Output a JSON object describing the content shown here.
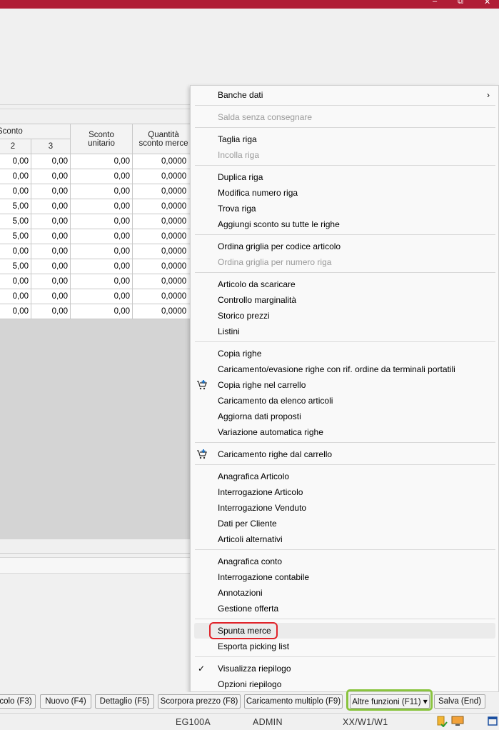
{
  "titlebar": {
    "color": "#b01e36",
    "minimize_glyph": "–",
    "restore_glyph": "⧉",
    "close_glyph": "✕"
  },
  "grid": {
    "header_group": "Sconto",
    "header_col2": "2",
    "header_col3": "3",
    "header_unitario": "Sconto unitario",
    "header_quantita": "Quantità sconto merce",
    "rows": [
      [
        "0,00",
        "0,00",
        "0,00",
        "0,0000"
      ],
      [
        "0,00",
        "0,00",
        "0,00",
        "0,0000"
      ],
      [
        "0,00",
        "0,00",
        "0,00",
        "0,0000"
      ],
      [
        "5,00",
        "0,00",
        "0,00",
        "0,0000"
      ],
      [
        "5,00",
        "0,00",
        "0,00",
        "0,0000"
      ],
      [
        "5,00",
        "0,00",
        "0,00",
        "0,0000"
      ],
      [
        "0,00",
        "0,00",
        "0,00",
        "0,0000"
      ],
      [
        "5,00",
        "0,00",
        "0,00",
        "0,0000"
      ],
      [
        "0,00",
        "0,00",
        "0,00",
        "0,0000"
      ],
      [
        "0,00",
        "0,00",
        "0,00",
        "0,0000"
      ],
      [
        "0,00",
        "0,00",
        "0,00",
        "0,0000"
      ]
    ]
  },
  "menu": {
    "items": [
      {
        "label": "Banche dati",
        "submenu": true
      },
      {
        "label": "Salda senza consegnare",
        "disabled": true
      },
      {
        "label": "Taglia riga"
      },
      {
        "label": "Incolla riga",
        "disabled": true
      },
      {
        "label": "Duplica riga"
      },
      {
        "label": "Modifica numero riga"
      },
      {
        "label": "Trova riga"
      },
      {
        "label": "Aggiungi sconto su tutte le righe"
      },
      {
        "label": "Ordina griglia per codice articolo"
      },
      {
        "label": "Ordina griglia per numero riga",
        "disabled": true
      },
      {
        "label": "Articolo da scaricare"
      },
      {
        "label": "Controllo marginalità"
      },
      {
        "label": "Storico prezzi"
      },
      {
        "label": "Listini"
      },
      {
        "label": "Copia righe"
      },
      {
        "label": "Caricamento/evasione righe con rif. ordine da terminali portatili"
      },
      {
        "label": "Copia righe nel carrello",
        "icon": "cart-add-icon"
      },
      {
        "label": "Caricamento da elenco articoli"
      },
      {
        "label": "Aggiorna dati proposti"
      },
      {
        "label": "Variazione automatica righe"
      },
      {
        "label": "Caricamento righe dal carrello",
        "icon": "cart-add-icon"
      },
      {
        "label": "Anagrafica Articolo"
      },
      {
        "label": "Interrogazione Articolo"
      },
      {
        "label": "Interrogazione Venduto"
      },
      {
        "label": "Dati per Cliente"
      },
      {
        "label": "Articoli alternativi"
      },
      {
        "label": "Anagrafica conto"
      },
      {
        "label": "Interrogazione contabile"
      },
      {
        "label": "Annotazioni"
      },
      {
        "label": "Gestione offerta"
      },
      {
        "label": "Spunta merce",
        "highlighted": true
      },
      {
        "label": "Esporta picking list"
      },
      {
        "label": "Visualizza riepilogo",
        "checked": true
      },
      {
        "label": "Opzioni riepilogo"
      }
    ],
    "submenu_arrow": "›",
    "check_glyph": "✓"
  },
  "buttons": {
    "b1": "colo (F3)",
    "b2": "Nuovo (F4)",
    "b3": "Dettaglio (F5)",
    "b4": "Scorpora prezzo (F8)",
    "b5": "Caricamento multiplo (F9)",
    "b6": "Altre funzioni (F11)",
    "b6_arrow": "▾",
    "b7": "Salva (End)"
  },
  "status": {
    "company": "EG100A",
    "user": "ADMIN",
    "path": "XX/W1/W1"
  },
  "colors": {
    "highlight_box": "#e0242b",
    "button_focus": "#8ac43f",
    "cart_icon": "#1a73c9"
  }
}
